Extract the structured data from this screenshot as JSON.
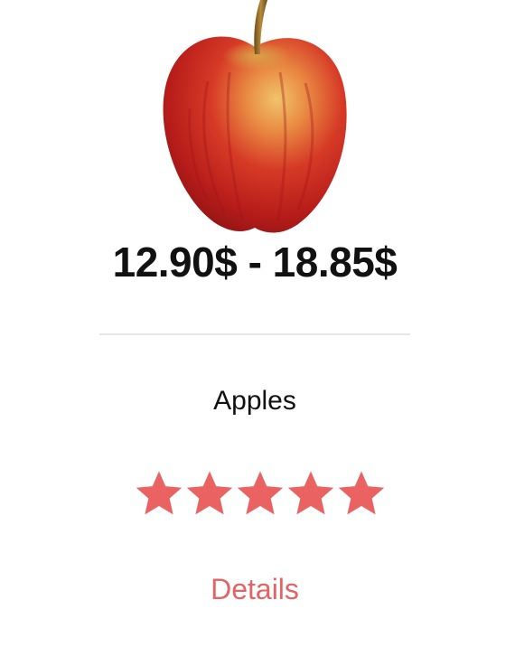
{
  "product": {
    "image_icon": "apple-product-image",
    "price_range": "12.90$ - 18.85$",
    "name": "Apples",
    "rating": {
      "value": 5,
      "max": 5,
      "color": "#ea6262"
    },
    "details_label": "Details",
    "accent_color": "#e26464"
  }
}
